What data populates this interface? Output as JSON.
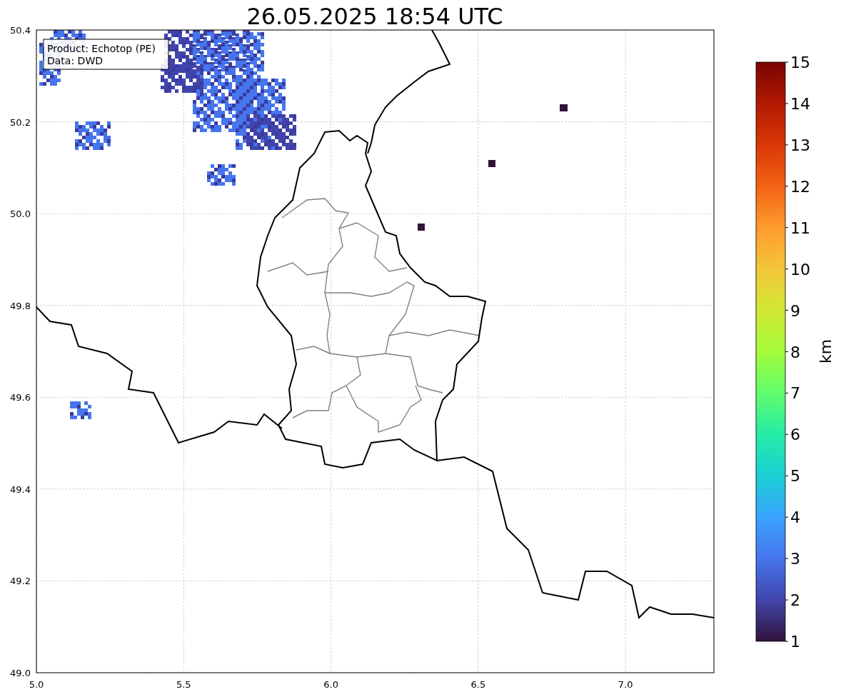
{
  "title": "26.05.2025 18:54 UTC",
  "info_box": {
    "lines": [
      "Product: Echotop (PE)",
      "Data: DWD"
    ]
  },
  "x_ticks": [
    "5.0",
    "5.5",
    "6.0",
    "6.5",
    "7.0"
  ],
  "y_ticks": [
    "50.4",
    "50.2",
    "50.0",
    "49.8",
    "49.6",
    "49.4",
    "49.2",
    "49.0"
  ],
  "colorbar": {
    "label": "km",
    "ticks": [
      "15",
      "14",
      "13",
      "12",
      "11",
      "10",
      "9",
      "8",
      "7",
      "6",
      "5",
      "4",
      "3",
      "2",
      "1"
    ]
  }
}
